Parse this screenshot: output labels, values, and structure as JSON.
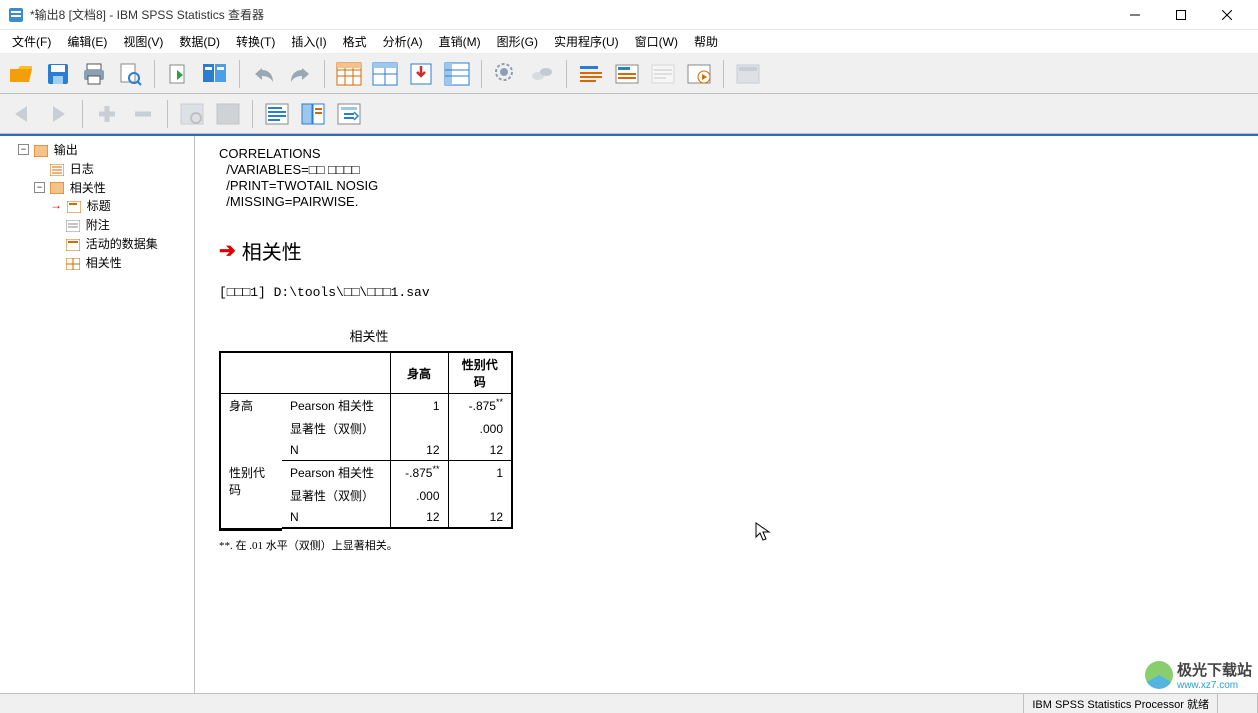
{
  "window": {
    "title": "*输出8 [文档8] - IBM SPSS Statistics 查看器"
  },
  "menu": {
    "file": "文件(F)",
    "edit": "编辑(E)",
    "view": "视图(V)",
    "data": "数据(D)",
    "transform": "转换(T)",
    "insert": "插入(I)",
    "format": "格式",
    "analyze": "分析(A)",
    "directmkt": "直销(M)",
    "graphs": "图形(G)",
    "utilities": "实用程序(U)",
    "window": "窗口(W)",
    "help": "帮助"
  },
  "outline": {
    "root": "输出",
    "log": "日志",
    "group": "相关性",
    "title": "标题",
    "notes": "附注",
    "activedata": "活动的数据集",
    "table": "相关性"
  },
  "syntax": {
    "l1": "CORRELATIONS",
    "l2": "  /VARIABLES=□□ □□□□",
    "l3": "  /PRINT=TWOTAIL NOSIG",
    "l4": "  /MISSING=PAIRWISE."
  },
  "section_title": "相关性",
  "dataset_line": "[□□□1] D:\\tools\\□□\\□□□1.sav",
  "table": {
    "caption": "相关性",
    "col1": "身高",
    "col2": "性别代码",
    "row1_label": "身高",
    "row2_label": "性别代码",
    "stat_pearson": "Pearson 相关性",
    "stat_sig": "显著性（双侧）",
    "stat_n": "N",
    "r1c1": "1",
    "r1c2": "-.875",
    "r1c2_star": "**",
    "r2c1": "",
    "r2c2": ".000",
    "r3c1": "12",
    "r3c2": "12",
    "r4c1": "-.875",
    "r4c1_star": "**",
    "r4c2": "1",
    "r5c1": ".000",
    "r5c2": "",
    "r6c1": "12",
    "r6c2": "12"
  },
  "footnote": "**. 在 .01 水平（双侧）上显著相关。",
  "status": {
    "processor": "IBM SPSS Statistics Processor 就绪"
  },
  "watermark": {
    "t1": "极光下载站",
    "t2": "www.xz7.com"
  }
}
